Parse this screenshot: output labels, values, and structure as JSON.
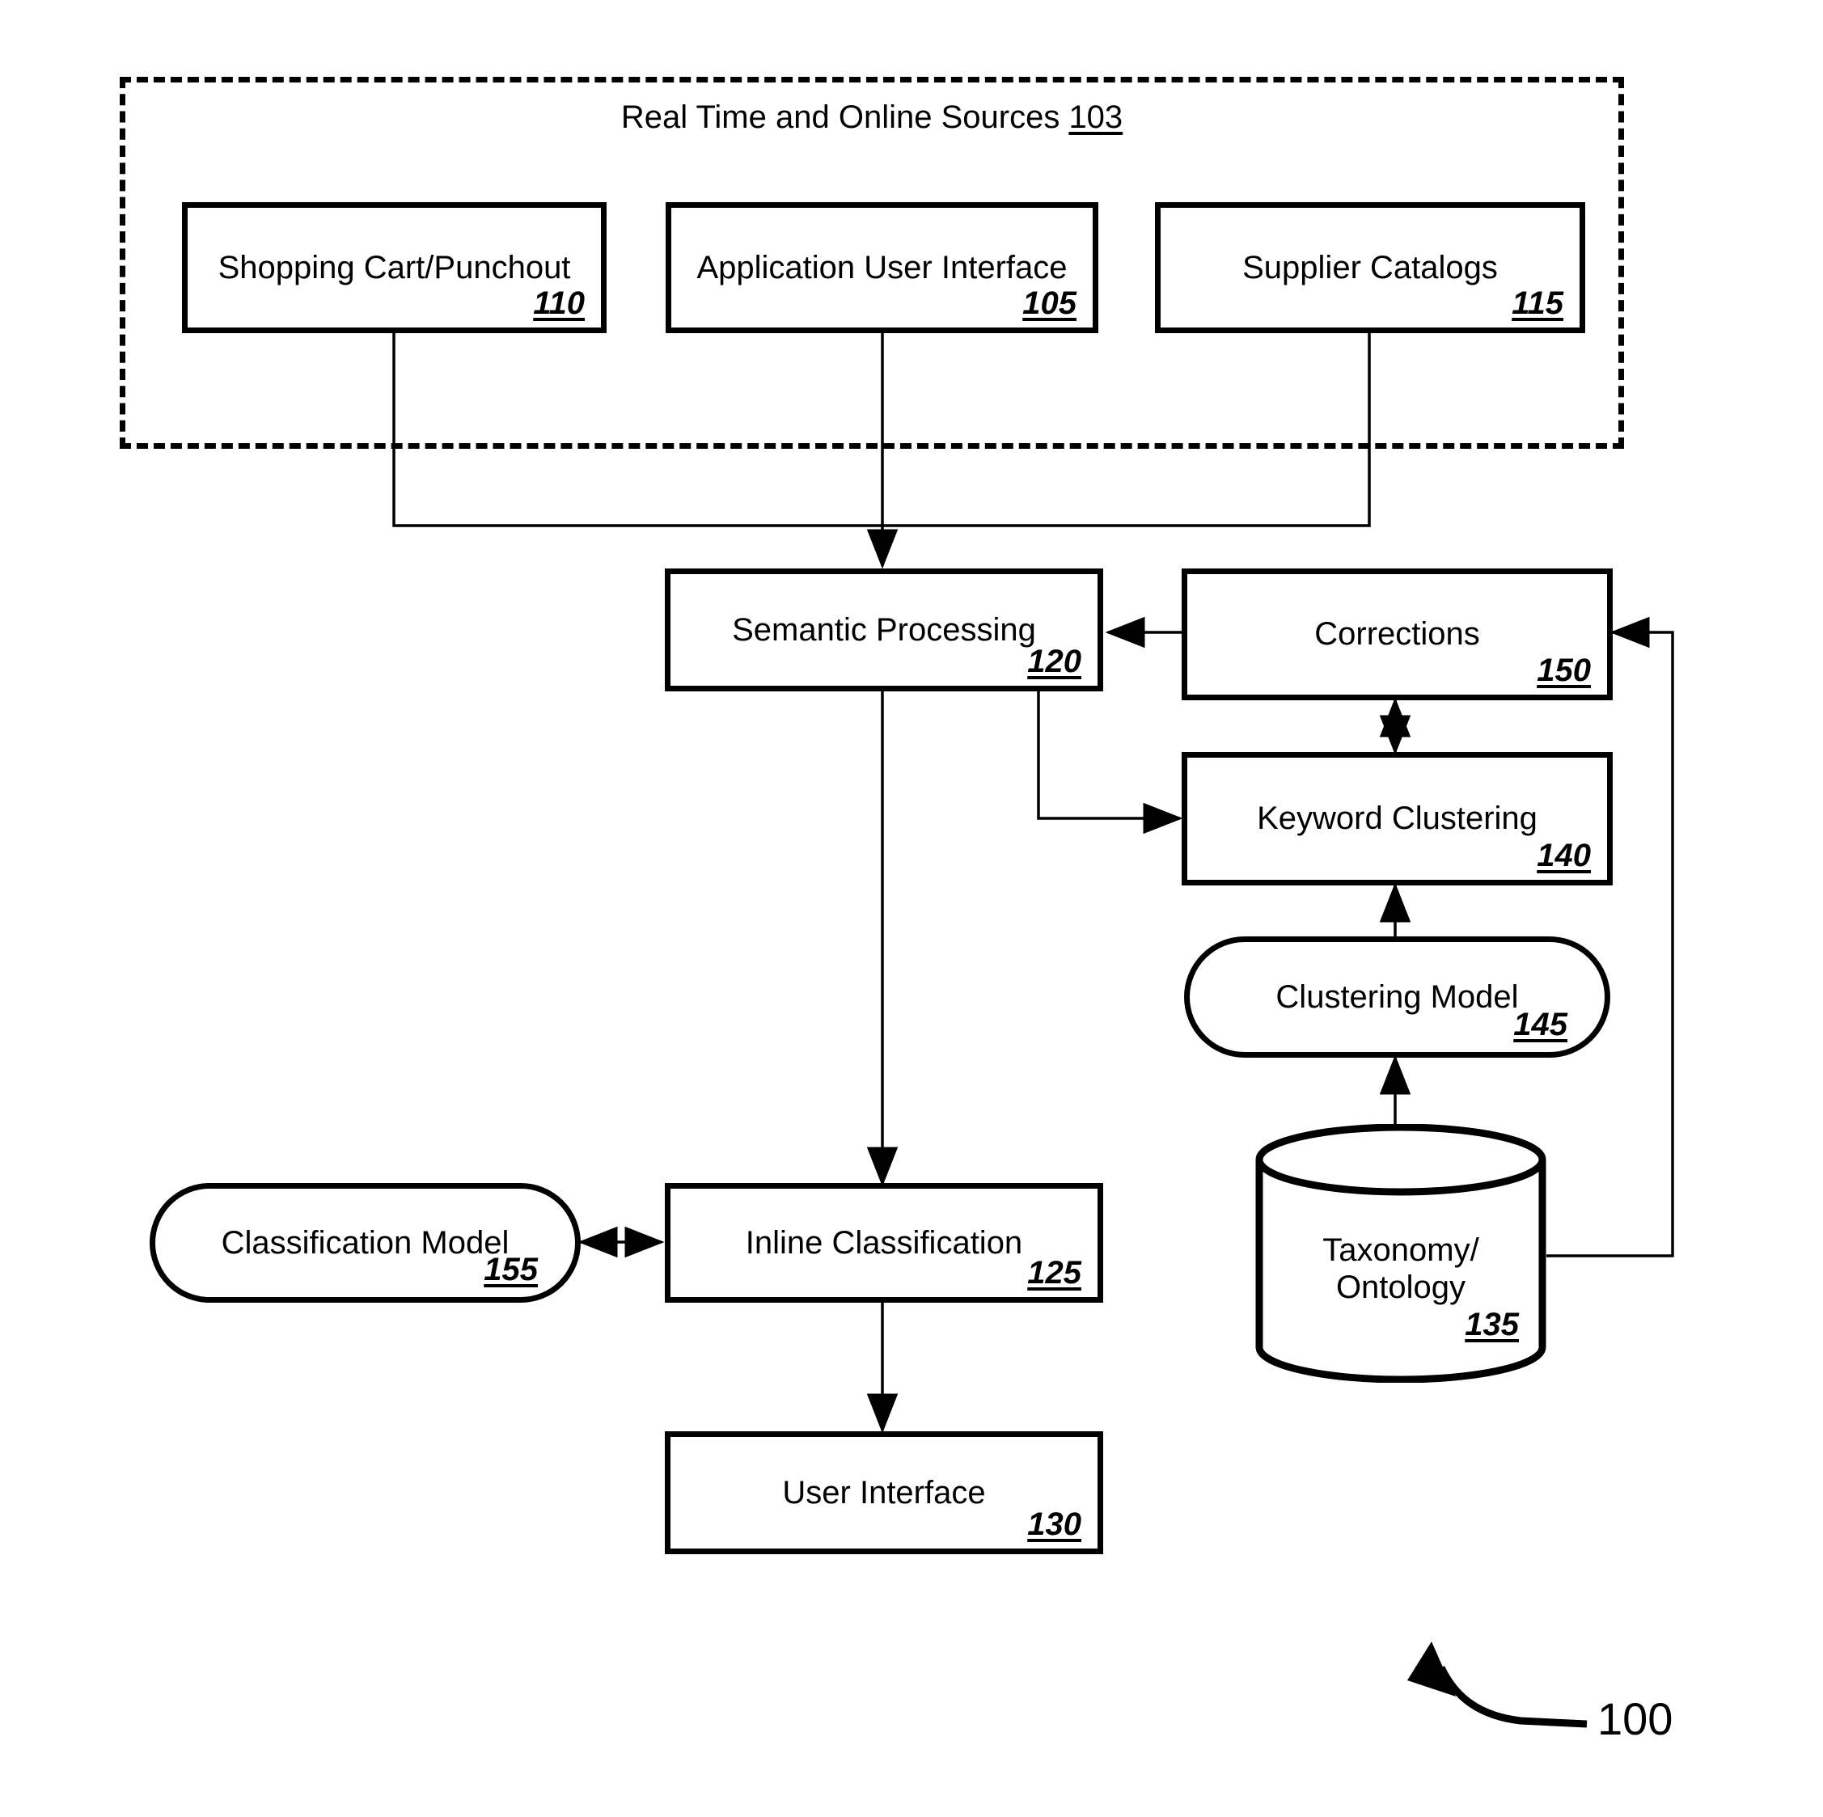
{
  "figure": {
    "number": "100",
    "callout_icon": "curved-arrow-icon"
  },
  "group": {
    "title_text": "Real Time and Online Sources",
    "title_ref": "103"
  },
  "nodes": {
    "shopping_cart": {
      "label": "Shopping Cart/Punchout",
      "ref": "110",
      "shape": "rect"
    },
    "application_ui": {
      "label": "Application User Interface",
      "ref": "105",
      "shape": "rect"
    },
    "supplier_catalogs": {
      "label": "Supplier Catalogs",
      "ref": "115",
      "shape": "rect"
    },
    "semantic_processing": {
      "label": "Semantic Processing",
      "ref": "120",
      "shape": "rect"
    },
    "corrections": {
      "label": "Corrections",
      "ref": "150",
      "shape": "rect"
    },
    "keyword_clustering": {
      "label": "Keyword Clustering",
      "ref": "140",
      "shape": "rect"
    },
    "clustering_model": {
      "label": "Clustering Model",
      "ref": "145",
      "shape": "stadium"
    },
    "taxonomy_ontology": {
      "label": "Taxonomy/\nOntology",
      "ref": "135",
      "shape": "cylinder"
    },
    "classification_model": {
      "label": "Classification Model",
      "ref": "155",
      "shape": "stadium"
    },
    "inline_classification": {
      "label": "Inline Classification",
      "ref": "125",
      "shape": "rect"
    },
    "user_interface": {
      "label": "User Interface",
      "ref": "130",
      "shape": "rect"
    }
  },
  "connections": [
    {
      "from": "shopping_cart",
      "to": "semantic_processing",
      "style": "orthogonal",
      "arrow": "single"
    },
    {
      "from": "application_ui",
      "to": "semantic_processing",
      "style": "straight",
      "arrow": "single"
    },
    {
      "from": "supplier_catalogs",
      "to": "semantic_processing",
      "style": "orthogonal",
      "arrow": "single"
    },
    {
      "from": "semantic_processing",
      "to": "inline_classification",
      "style": "straight",
      "arrow": "single"
    },
    {
      "from": "semantic_processing",
      "to": "keyword_clustering",
      "style": "orthogonal",
      "arrow": "single"
    },
    {
      "from": "corrections",
      "to": "semantic_processing",
      "style": "straight",
      "arrow": "single"
    },
    {
      "from": "corrections",
      "to": "keyword_clustering",
      "style": "straight",
      "arrow": "double"
    },
    {
      "from": "clustering_model",
      "to": "keyword_clustering",
      "style": "straight",
      "arrow": "single"
    },
    {
      "from": "taxonomy_ontology",
      "to": "clustering_model",
      "style": "straight",
      "arrow": "single"
    },
    {
      "from": "taxonomy_ontology",
      "to": "corrections",
      "style": "orthogonal",
      "arrow": "single"
    },
    {
      "from": "classification_model",
      "to": "inline_classification",
      "style": "straight",
      "arrow": "double"
    },
    {
      "from": "inline_classification",
      "to": "user_interface",
      "style": "straight",
      "arrow": "single"
    }
  ],
  "colors": {
    "stroke": "#000000",
    "background": "#ffffff"
  }
}
